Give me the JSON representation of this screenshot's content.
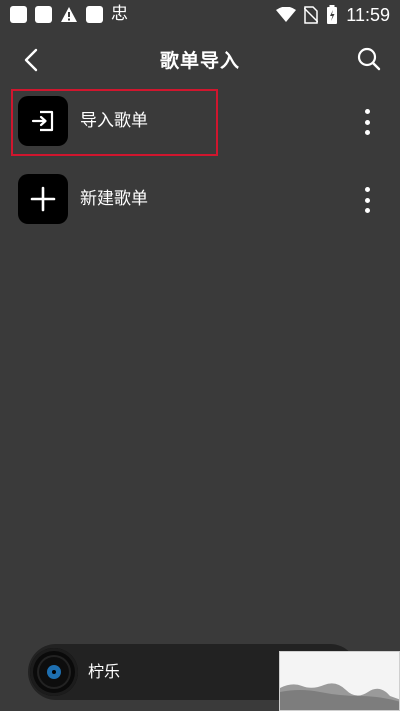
{
  "status_bar": {
    "time": "11:59",
    "battery_glyph": "⚡",
    "notif_glyph": "忠",
    "icons": [
      "notification-square-icon",
      "notification-square-icon",
      "warning-icon",
      "notification-square-icon",
      "app-glyph-icon",
      "wifi-icon",
      "no-sim-icon",
      "battery-charging-icon"
    ]
  },
  "header": {
    "title": "歌单导入",
    "back_icon": "chevron-left-icon",
    "search_icon": "search-icon"
  },
  "list": {
    "items": [
      {
        "label": "导入歌单",
        "icon": "import-icon"
      },
      {
        "label": "新建歌单",
        "icon": "plus-icon"
      }
    ]
  },
  "player": {
    "title": "柠乐",
    "disc_color": "#1e6fb0"
  },
  "colors": {
    "background": "#3a3a3a",
    "highlight": "#d0162e"
  }
}
